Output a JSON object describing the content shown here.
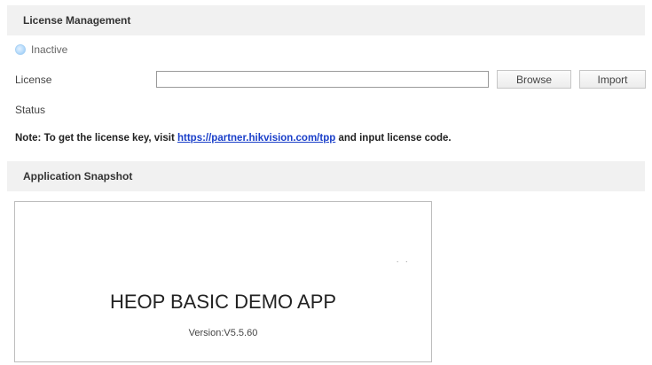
{
  "license_management": {
    "title": "License Management",
    "status_text": "Inactive",
    "license_label": "License",
    "license_value": "",
    "browse_label": "Browse",
    "import_label": "Import",
    "status_label": "Status",
    "note_prefix": "Note: To get the license key, visit ",
    "note_link": "https://partner.hikvision.com/tpp",
    "note_suffix": " and input license code."
  },
  "application_snapshot": {
    "title": "Application Snapshot",
    "dots": "· ·",
    "app_name": "HEOP BASIC DEMO APP",
    "version": "Version:V5.5.60"
  },
  "colors": {
    "header_bg": "#f1f1f1",
    "link": "#1a3fc9",
    "status_dot": "#b9dcfb"
  }
}
